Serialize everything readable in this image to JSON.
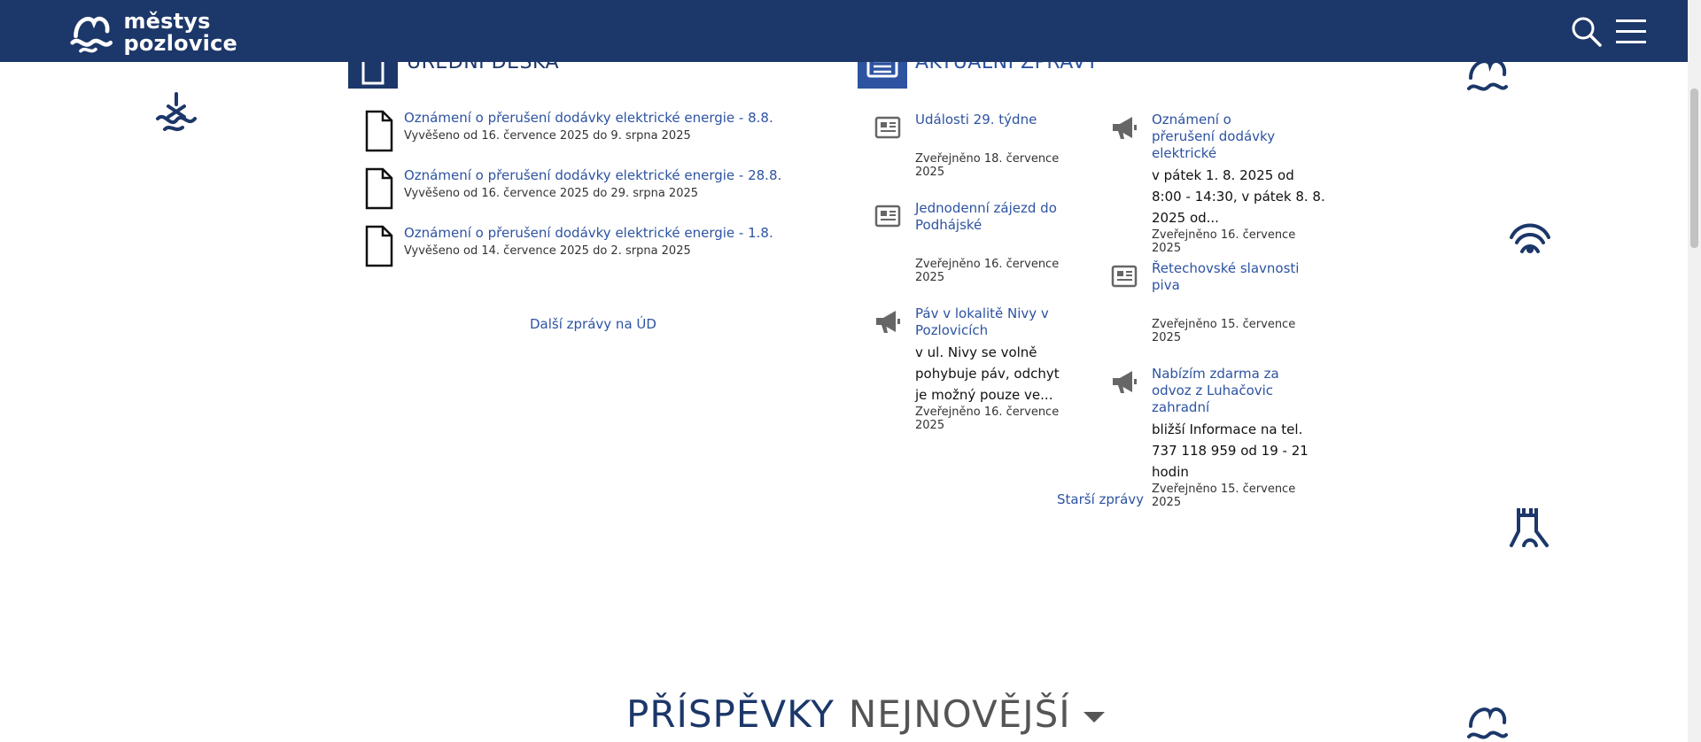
{
  "header": {
    "logo_line1": "městys",
    "logo_line2": "pozlovice"
  },
  "colors": {
    "brand": "#1c3769",
    "link": "#2d53a1",
    "accent_box": "#2d53a1"
  },
  "icons": {
    "search": "search-icon",
    "menu": "hamburger-menu-icon",
    "document": "document-icon",
    "news": "newspaper-icon",
    "announcement": "megaphone-icon"
  },
  "board": {
    "title": "ÚŘEDNÍ DESKA",
    "items": [
      {
        "title": "Oznámení o přerušení dodávky elektrické energie - 8.8.",
        "meta": "Vyvěšeno od 16. července 2025 do 9. srpna 2025"
      },
      {
        "title": "Oznámení o přerušení dodávky elektrické energie - 28.8.",
        "meta": "Vyvěšeno od 16. července 2025 do 29. srpna 2025"
      },
      {
        "title": "Oznámení o přerušení dodávky elektrické energie - 1.8.",
        "meta": "Vyvěšeno od 14. července 2025 do 2. srpna 2025"
      }
    ],
    "more_link": "Další zprávy na ÚD"
  },
  "news": {
    "title": "AKTUÁLNÍ ZPRÁVY",
    "left": [
      {
        "title": "Události 29. týdne",
        "body": "",
        "date1": "Zveřejněno 18. července",
        "date2": "2025"
      },
      {
        "title": "Jednodenní zájezd do Podhájské",
        "body": "",
        "date1": "Zveřejněno 16. července",
        "date2": "2025"
      },
      {
        "title": "Páv v lokalitě Nivy v Pozlovicích",
        "body": "v ul. Nivy se volně pohybuje páv, odchyt je možný pouze ve...",
        "date1": "Zveřejněno 16. července",
        "date2": "2025"
      }
    ],
    "right": [
      {
        "title": "Oznámení o přerušení dodávky elektrické",
        "body": "v pátek 1. 8. 2025 od 8:00 - 14:30, v pátek 8. 8. 2025 od...",
        "date1": "Zveřejněno 16. července",
        "date2": "2025"
      },
      {
        "title": "Řetechovské slavnosti piva",
        "body": "",
        "date1": "Zveřejněno 15. července",
        "date2": "2025"
      },
      {
        "title": "Nabízím zdarma za odvoz z Luhačovic zahradní",
        "body": "bližší Informace na tel. 737 118 959 od 19 - 21 hodin",
        "date1": "Zveřejněno 15. července",
        "date2": "2025"
      }
    ],
    "more_link": "Starší zprávy"
  },
  "posts": {
    "heading": "PŘÍSPĚVKY",
    "filter": "NEJNOVĚJŠÍ"
  }
}
